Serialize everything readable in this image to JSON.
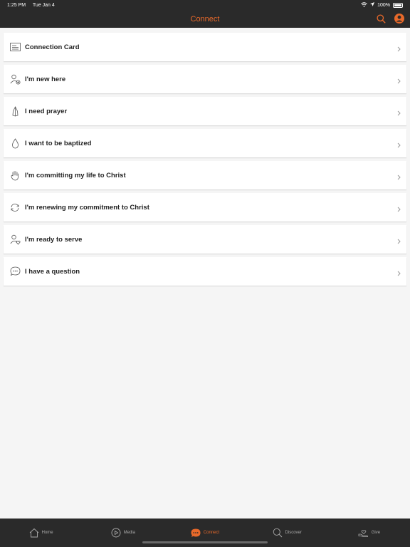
{
  "status_bar": {
    "time": "1:25 PM",
    "date": "Tue Jan 4",
    "battery": "100%"
  },
  "header": {
    "title": "Connect",
    "icons": [
      "search-icon",
      "profile-icon"
    ]
  },
  "colors": {
    "accent": "#e8692a",
    "bar": "#2a2a2a",
    "background": "#f5f5f5"
  },
  "items": [
    {
      "label": "Connection Card",
      "icon": "card-icon"
    },
    {
      "label": "I'm new here",
      "icon": "person-add-icon"
    },
    {
      "label": "I need prayer",
      "icon": "praying-hands-icon"
    },
    {
      "label": "I want to be baptized",
      "icon": "water-drop-icon"
    },
    {
      "label": "I'm committing my life to Christ",
      "icon": "raised-hand-icon"
    },
    {
      "label": "I'm renewing my commitment to Christ",
      "icon": "refresh-icon"
    },
    {
      "label": "I'm ready to serve",
      "icon": "person-heart-icon"
    },
    {
      "label": "I have a question",
      "icon": "chat-bubble-icon"
    }
  ],
  "tabs": [
    {
      "label": "Home",
      "icon": "home-icon"
    },
    {
      "label": "Media",
      "icon": "play-icon"
    },
    {
      "label": "Connect",
      "icon": "chat-icon",
      "active": true
    },
    {
      "label": "Discover",
      "icon": "search-icon"
    },
    {
      "label": "Give",
      "icon": "give-icon"
    }
  ]
}
